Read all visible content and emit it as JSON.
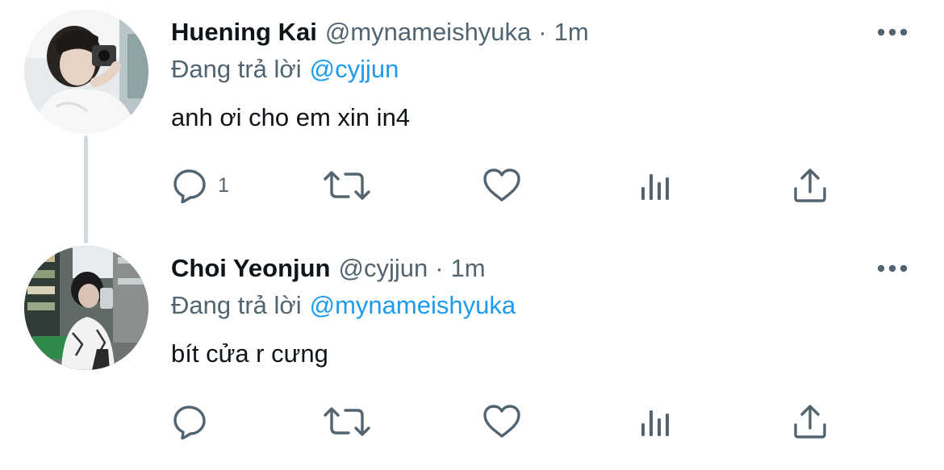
{
  "thread": [
    {
      "display_name": "Huening Kai",
      "handle": "@mynameishyuka",
      "separator": "·",
      "time": "1m",
      "reply_prefix": "Đang trả lời",
      "reply_to": "@cyjjun",
      "text": "anh ơi cho em xin in4",
      "reply_count": "1",
      "avatar_icon": "avatar-photo"
    },
    {
      "display_name": "Choi Yeonjun",
      "handle": "@cyjjun",
      "separator": "·",
      "time": "1m",
      "reply_prefix": "Đang trả lời",
      "reply_to": "@mynameishyuka",
      "text": "bít cửa r cưng",
      "reply_count": "",
      "avatar_icon": "avatar-photo"
    }
  ],
  "icons": {
    "reply": "speech-bubble-icon",
    "retweet": "retweet-icon",
    "like": "heart-icon",
    "views": "analytics-bars-icon",
    "share": "share-upload-icon",
    "more": "more-dots-icon"
  },
  "colors": {
    "text_primary": "#0f1419",
    "text_secondary": "#536471",
    "accent_link": "#1d9bf0",
    "thread_line": "#cfd9de",
    "icon": "#536471"
  }
}
